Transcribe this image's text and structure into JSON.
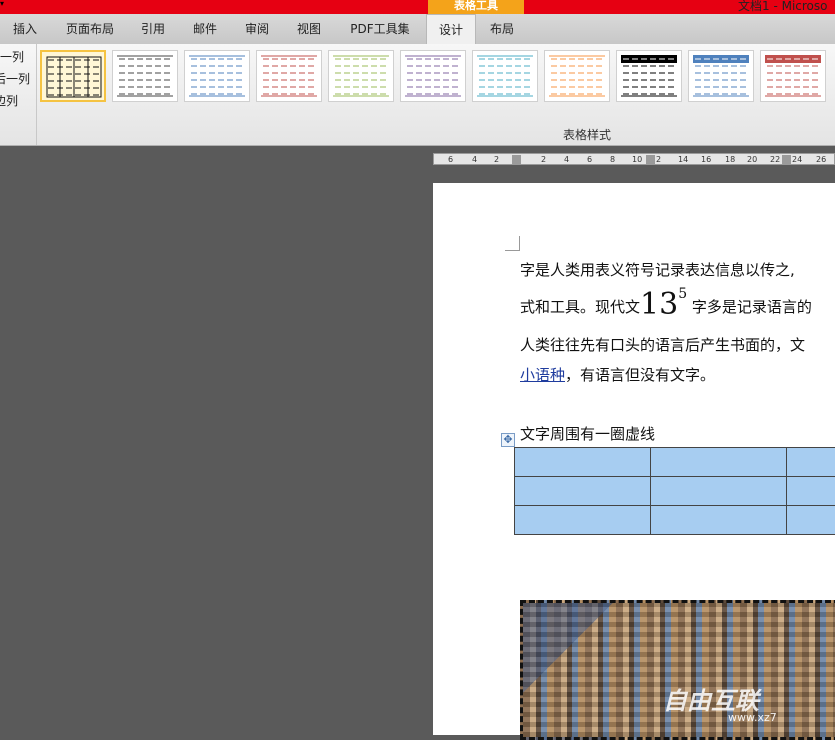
{
  "title_bar": {
    "context_tab": "表格工具",
    "doc_title": "文档1 - Microso"
  },
  "tabs": [
    {
      "label": "插入"
    },
    {
      "label": "页面布局"
    },
    {
      "label": "引用"
    },
    {
      "label": "邮件"
    },
    {
      "label": "审阅"
    },
    {
      "label": "视图"
    },
    {
      "label": "PDF工具集"
    },
    {
      "label": "设计",
      "active": true
    },
    {
      "label": "布局"
    }
  ],
  "ribbon": {
    "left_options": [
      "一列",
      "后一列",
      "边列"
    ],
    "group_label": "表格样式",
    "styles": [
      {
        "color": "#111111",
        "selected": true
      },
      {
        "color": "#444444"
      },
      {
        "color": "#4f81bd"
      },
      {
        "color": "#c0504d"
      },
      {
        "color": "#9bbb59"
      },
      {
        "color": "#8064a2"
      },
      {
        "color": "#4bacc6"
      },
      {
        "color": "#f79646"
      },
      {
        "color": "#000000",
        "header": true
      },
      {
        "color": "#4f81bd",
        "header": true
      },
      {
        "color": "#c0504d",
        "header": true
      }
    ]
  },
  "ruler": {
    "numbers": [
      "6",
      "4",
      "2",
      "2",
      "4",
      "6",
      "8",
      "10",
      "2",
      "14",
      "16",
      "18",
      "20",
      "22",
      "24",
      "26"
    ]
  },
  "document": {
    "line1": "字是人类用表义符号记录表达信息以传之,",
    "line2_a": "式和工具。现代文",
    "line2_big": "13",
    "line2_sup": "5",
    "line2_b": "字多是记录语言的",
    "line3": "人类往往先有口头的语言后产生书面的，文",
    "line4_link": "小语种",
    "line4_rest": "，有语言但没有文字。",
    "caption": "文字周围有一圈虚线",
    "table_rows": 3,
    "table_cols": 3,
    "watermark": "自由互联",
    "watermark_url": "www.xz7"
  }
}
